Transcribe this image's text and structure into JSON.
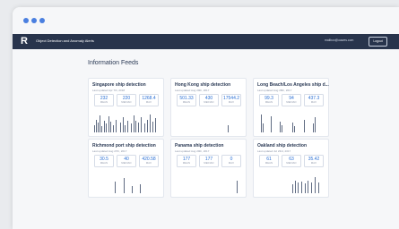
{
  "window": {
    "dots": [
      "#4a7fe0",
      "#4a7fe0",
      "#4a7fe0"
    ]
  },
  "app": {
    "logo": "R",
    "title": "Object Detection and Anomaly Alerts",
    "user_email": "mailbox@oawes.com",
    "logout_label": "Logout"
  },
  "page": {
    "heading": "Information Feeds"
  },
  "stat_labels": [
    "MEAN",
    "MEDIAN",
    "MAX"
  ],
  "cards": [
    {
      "title": "Singapore ship detection",
      "updated": "Last updated Apr 7th, 2018",
      "stats": [
        "232",
        "220",
        "1268.4"
      ],
      "bars": [
        [
          0.5,
          0.35
        ],
        [
          2.5,
          0.6
        ],
        [
          4.5,
          0.45
        ],
        [
          6.5,
          0.8
        ],
        [
          8.5,
          0.3
        ],
        [
          12,
          0.55
        ],
        [
          14,
          0.4
        ],
        [
          17,
          0.75
        ],
        [
          19,
          0.5
        ],
        [
          22,
          0.35
        ],
        [
          25,
          0.6
        ],
        [
          30,
          0.45
        ],
        [
          33,
          0.7
        ],
        [
          35,
          0.35
        ],
        [
          38,
          0.55
        ],
        [
          42,
          0.4
        ],
        [
          45,
          0.8
        ],
        [
          47,
          0.55
        ],
        [
          50,
          0.45
        ],
        [
          53,
          0.7
        ],
        [
          57,
          0.4
        ],
        [
          60,
          0.6
        ],
        [
          63,
          0.85
        ],
        [
          66,
          0.5
        ],
        [
          69,
          0.65
        ]
      ]
    },
    {
      "title": "Hong Kong ship detection",
      "updated": "Last updated Aug 29th, 2017",
      "stats": [
        "501.33",
        "430",
        "17544.2"
      ],
      "bars": [
        [
          58,
          0.35
        ]
      ]
    },
    {
      "title": "Long Beach/Los Angeles ship d...",
      "updated": "Last updated Aug 28th, 2017",
      "stats": [
        "99.3",
        "94",
        "437.3"
      ],
      "bars": [
        [
          3,
          0.85
        ],
        [
          5,
          0.4
        ],
        [
          14,
          0.75
        ],
        [
          24,
          0.5
        ],
        [
          26,
          0.35
        ],
        [
          38,
          0.45
        ],
        [
          40,
          0.3
        ],
        [
          51,
          0.6
        ],
        [
          61,
          0.4
        ],
        [
          63,
          0.7
        ]
      ]
    },
    {
      "title": "Richmond port ship detection",
      "updated": "Last updated Aug 27th, 2017",
      "stats": [
        "30.5",
        "40",
        "420.58"
      ],
      "bars": [
        [
          24,
          0.55
        ],
        [
          34,
          0.7
        ],
        [
          43,
          0.35
        ],
        [
          52,
          0.4
        ]
      ]
    },
    {
      "title": "Panama ship detection",
      "updated": "Last updated Aug 29th, 2017",
      "stats": [
        "177",
        "177",
        "0"
      ],
      "bars": [
        [
          68,
          0.6
        ]
      ]
    },
    {
      "title": "Oakland ship detection",
      "updated": "Last updated Jul 23rd, 2017",
      "stats": [
        "61",
        "63",
        "35.42"
      ],
      "bars": [
        [
          38,
          0.4
        ],
        [
          41,
          0.6
        ],
        [
          44,
          0.5
        ],
        [
          48,
          0.55
        ],
        [
          52,
          0.45
        ],
        [
          55,
          0.6
        ],
        [
          59,
          0.5
        ],
        [
          63,
          0.75
        ],
        [
          67,
          0.5
        ]
      ]
    }
  ]
}
